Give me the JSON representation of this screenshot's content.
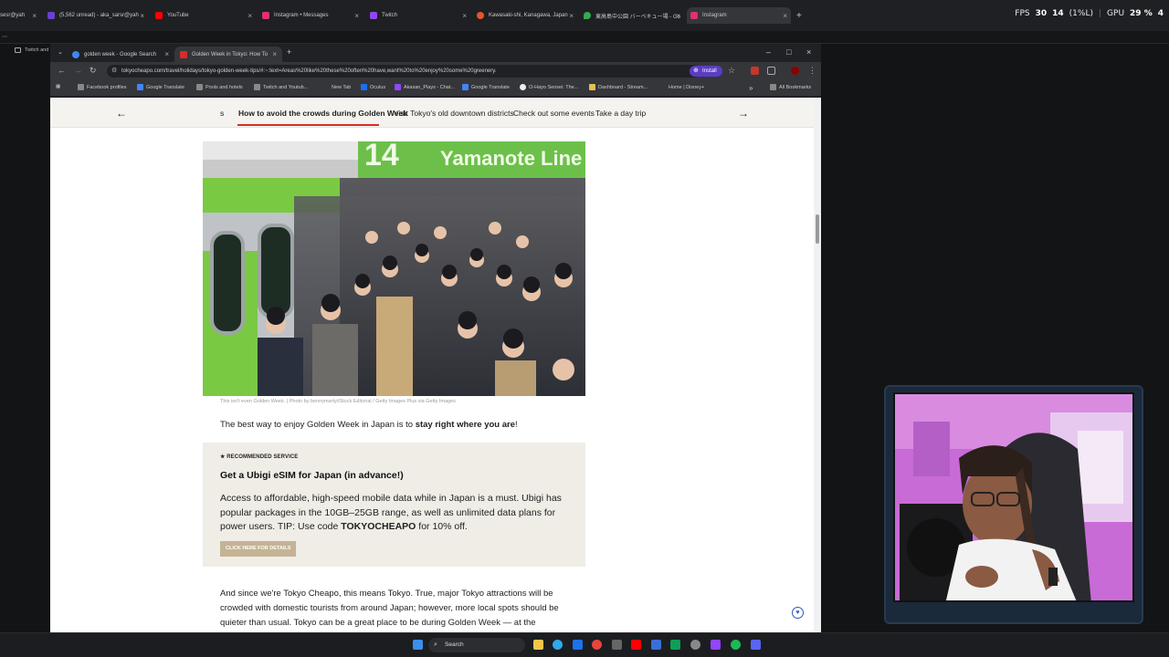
{
  "outer_tabs": [
    {
      "label": "sesr@yah",
      "color": "#7b68ee"
    },
    {
      "label": "(5,562 unread) - aka_sarsr@yah",
      "color": "#6a3fd0"
    },
    {
      "label": "YouTube",
      "color": "#ff0000"
    },
    {
      "label": "Instagram • Messages",
      "color": "#e1306c"
    },
    {
      "label": "Twitch",
      "color": "#9146ff"
    },
    {
      "label": "Kawasaki-shi, Kanagawa, Japan",
      "color": "#e2562b"
    },
    {
      "label": "東高島中公園 バーベキュー場 - Go",
      "color": "#34a853"
    },
    {
      "label": "Instagram",
      "color": "#e1306c"
    }
  ],
  "perf": {
    "fps_label": "FPS",
    "fps": "30",
    "cpu": "14",
    "cpu_pct": "(1%L)",
    "gpu_label": "GPU",
    "gpu": "29 %",
    "extra": "4"
  },
  "strip2": {
    "label": "Twitch and"
  },
  "window_tabs": [
    {
      "label": "golden week - Google Search",
      "color": "#4285f4"
    },
    {
      "label": "Golden Week in Tokyo: How To",
      "color": "#d62c2c"
    }
  ],
  "address": {
    "url": "tokyocheapo.com/travel/holidays/tokyo-golden-week-tips/#:~:text=Areas%20like%20these%20often%20have,want%20to%20enjoy%20some%20greenery.",
    "install": "Install"
  },
  "bookmarks": [
    "Facebook profiles",
    "Google Translate",
    "Pools and hotels",
    "Twitch and Youtub...",
    "New Tab",
    "Oculus",
    "Akasan_Plays - Chat...",
    "Google Translate",
    "O-Hayo Sensei: The...",
    "Dashboard - Stream...",
    "Home | Disney+",
    "All Bookmarks"
  ],
  "section_nav": {
    "partial": "s",
    "items": [
      "How to avoid the crowds during Golden Week",
      "Visit Tokyo's old downtown districts",
      "Check out some events",
      "Take a day trip"
    ],
    "prev_icon": "←",
    "next_icon": "→"
  },
  "photo": {
    "sign": "Yamanote Line",
    "sign_num": "14",
    "caption": "This isn't even Golden Week. | Photo by bennymarty/iStock Editorial / Getty Images Plus via Getty Images"
  },
  "para1": {
    "before": "The best way to enjoy Golden Week in Japan is to ",
    "bold": "stay right where you are",
    "after": "!"
  },
  "promo": {
    "tag": "RECOMMENDED SERVICE",
    "title": "Get a Ubigi eSIM for Japan (in advance!)",
    "body_before": "Access to affordable, high-speed mobile data while in Japan is a must. Ubigi has popular packages in the 10GB–25GB range, as well as unlimited data plans for power users. TIP: Use code ",
    "code": "TOKYOCHEAPO",
    "body_after": " for 10% off.",
    "button": "CLICK HERE FOR DETAILS"
  },
  "para2": "And since we're Tokyo Cheapo, this means Tokyo. True, major Tokyo attractions will be crowded with domestic tourists from around Japan; however, more local spots should be quieter than usual. Tokyo can be a great place to be during Golden Week — at the",
  "taskbar": {
    "search": "Search"
  }
}
